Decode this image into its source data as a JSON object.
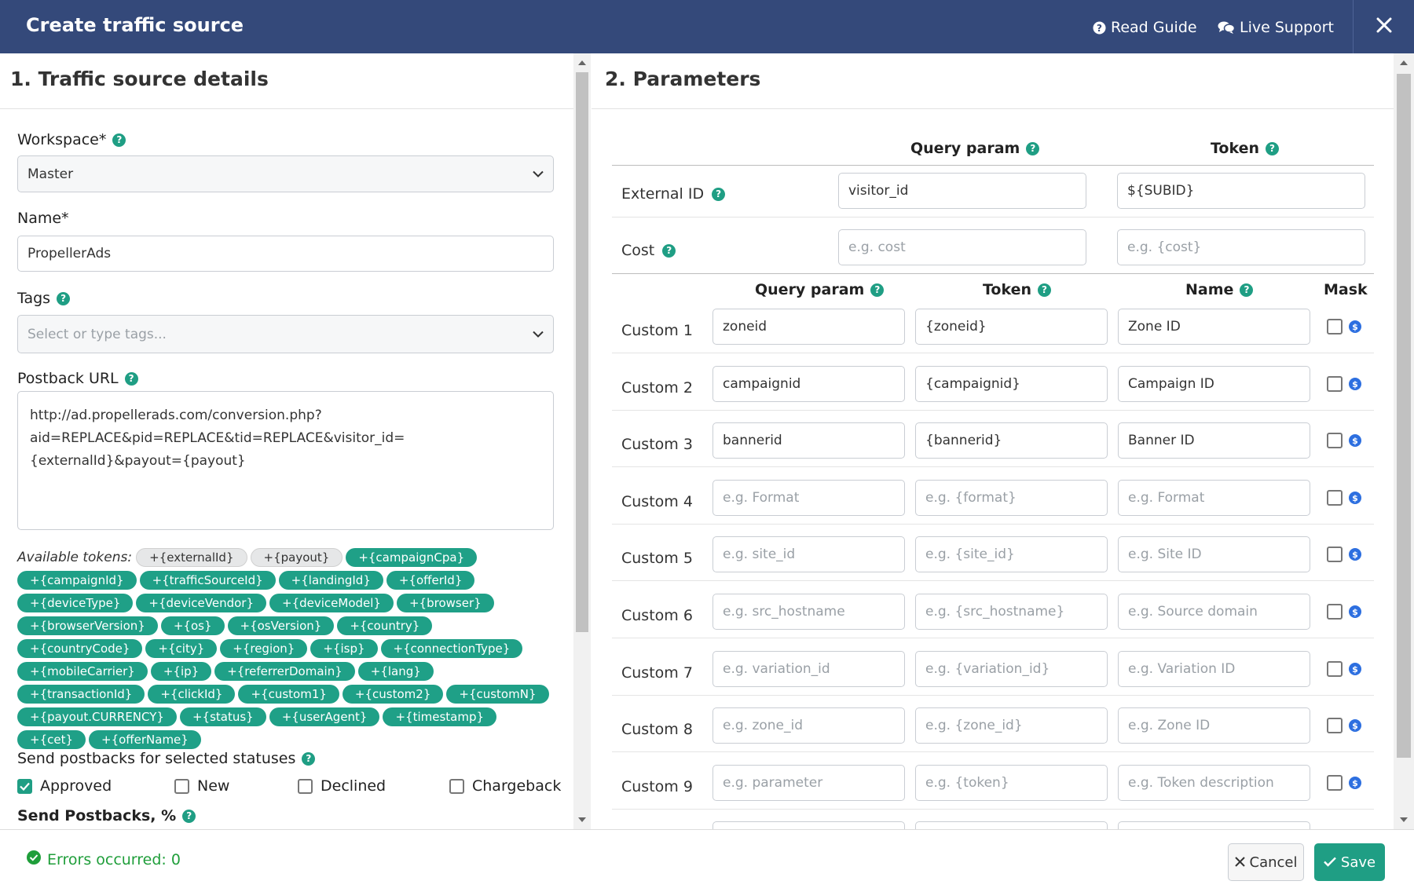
{
  "header": {
    "title": "Create traffic source",
    "read_guide": "Read Guide",
    "live_support": "Live Support"
  },
  "left": {
    "section_title": "1. Traffic source details",
    "workspace": {
      "label": "Workspace*",
      "value": "Master"
    },
    "name": {
      "label": "Name*",
      "value": "PropellerAds"
    },
    "tags": {
      "label": "Tags",
      "placeholder": "Select or type tags..."
    },
    "postback": {
      "label": "Postback URL",
      "value": "http://ad.propellerads.com/conversion.php?\naid=REPLACE&pid=REPLACE&tid=REPLACE&visitor_id=\n{externalId}&payout={payout}"
    },
    "tokens_label": "Available tokens:",
    "tokens_gray": [
      "+{externalId}",
      "+{payout}"
    ],
    "tokens_green": [
      "+{campaignCpa}",
      "+{campaignId}",
      "+{trafficSourceId}",
      "+{landingId}",
      "+{offerId}",
      "+{deviceType}",
      "+{deviceVendor}",
      "+{deviceModel}",
      "+{browser}",
      "+{browserVersion}",
      "+{os}",
      "+{osVersion}",
      "+{country}",
      "+{countryCode}",
      "+{city}",
      "+{region}",
      "+{isp}",
      "+{connectionType}",
      "+{mobileCarrier}",
      "+{ip}",
      "+{referrerDomain}",
      "+{lang}",
      "+{transactionId}",
      "+{clickId}",
      "+{custom1}",
      "+{custom2}",
      "+{customN}",
      "+{payout.CURRENCY}",
      "+{status}",
      "+{userAgent}",
      "+{timestamp}",
      "+{cet}",
      "+{offerName}"
    ],
    "statuses_label": "Send postbacks for selected statuses",
    "statuses": [
      {
        "label": "Approved",
        "checked": true
      },
      {
        "label": "New",
        "checked": false
      },
      {
        "label": "Declined",
        "checked": false
      },
      {
        "label": "Chargeback",
        "checked": false
      }
    ],
    "send_postbacks_label": "Send Postbacks, %"
  },
  "right": {
    "section_title": "2. Parameters",
    "top_headers": {
      "query": "Query param",
      "token": "Token"
    },
    "external_id": {
      "label": "External ID",
      "query": "visitor_id",
      "token": "${SUBID}"
    },
    "cost": {
      "label": "Cost",
      "query_ph": "e.g. cost",
      "token_ph": "e.g. {cost}"
    },
    "custom_headers": {
      "query": "Query param",
      "token": "Token",
      "name": "Name",
      "mask": "Mask"
    },
    "customs": [
      {
        "label": "Custom 1",
        "query": "zoneid",
        "token": "{zoneid}",
        "name": "Zone ID"
      },
      {
        "label": "Custom 2",
        "query": "campaignid",
        "token": "{campaignid}",
        "name": "Campaign ID"
      },
      {
        "label": "Custom 3",
        "query": "bannerid",
        "token": "{bannerid}",
        "name": "Banner ID"
      },
      {
        "label": "Custom 4",
        "query_ph": "e.g. Format",
        "token_ph": "e.g. {format}",
        "name_ph": "e.g. Format"
      },
      {
        "label": "Custom 5",
        "query_ph": "e.g. site_id",
        "token_ph": "e.g. {site_id}",
        "name_ph": "e.g. Site ID"
      },
      {
        "label": "Custom 6",
        "query_ph": "e.g. src_hostname",
        "token_ph": "e.g. {src_hostname}",
        "name_ph": "e.g. Source domain"
      },
      {
        "label": "Custom 7",
        "query_ph": "e.g. variation_id",
        "token_ph": "e.g. {variation_id}",
        "name_ph": "e.g. Variation ID"
      },
      {
        "label": "Custom 8",
        "query_ph": "e.g. zone_id",
        "token_ph": "e.g. {zone_id}",
        "name_ph": "e.g. Zone ID"
      },
      {
        "label": "Custom 9",
        "query_ph": "e.g. parameter",
        "token_ph": "e.g. {token}",
        "name_ph": "e.g. Token description"
      }
    ]
  },
  "footer": {
    "errors": "Errors occurred: 0",
    "cancel": "Cancel",
    "save": "Save"
  }
}
